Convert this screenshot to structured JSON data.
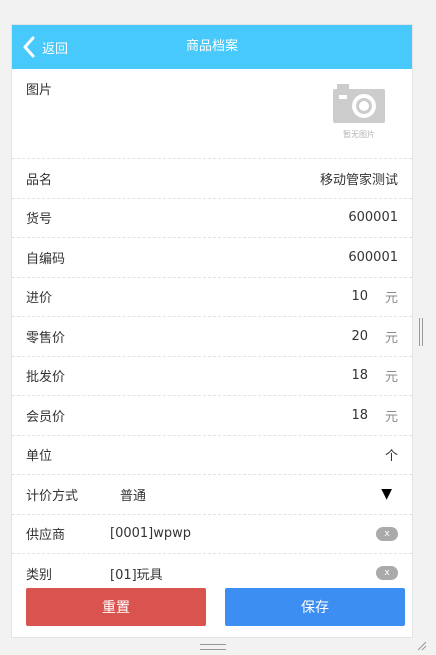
{
  "header": {
    "back_label": "返回",
    "title": "商品档案"
  },
  "picture": {
    "label": "图片",
    "placeholder_text": "暂无图片"
  },
  "fields": {
    "name": {
      "label": "品名",
      "value": "移动管家测试"
    },
    "item_no": {
      "label": "货号",
      "value": "600001"
    },
    "self_code": {
      "label": "自编码",
      "value": "600001"
    },
    "purchase_price": {
      "label": "进价",
      "value": "10",
      "unit": "元"
    },
    "retail_price": {
      "label": "零售价",
      "value": "20",
      "unit": "元"
    },
    "wholesale_price": {
      "label": "批发价",
      "value": "18",
      "unit": "元"
    },
    "member_price": {
      "label": "会员价",
      "value": "18",
      "unit": "元"
    },
    "unit": {
      "label": "单位",
      "value": "个"
    },
    "pricing_method": {
      "label": "计价方式",
      "value": "普通"
    },
    "supplier": {
      "label": "供应商",
      "value": "[0001]wpwp",
      "clear_label": "x"
    },
    "category": {
      "label": "类别",
      "value": "[01]玩具",
      "clear_label": "x"
    }
  },
  "footer": {
    "reset_label": "重置",
    "save_label": "保存"
  },
  "colors": {
    "header_bg": "#47c9fb",
    "reset_bg": "#d9534f",
    "save_bg": "#3d8ef2"
  },
  "icons": {
    "back": "chevron-left-icon",
    "camera": "camera-icon",
    "select": "caret-down-icon"
  }
}
